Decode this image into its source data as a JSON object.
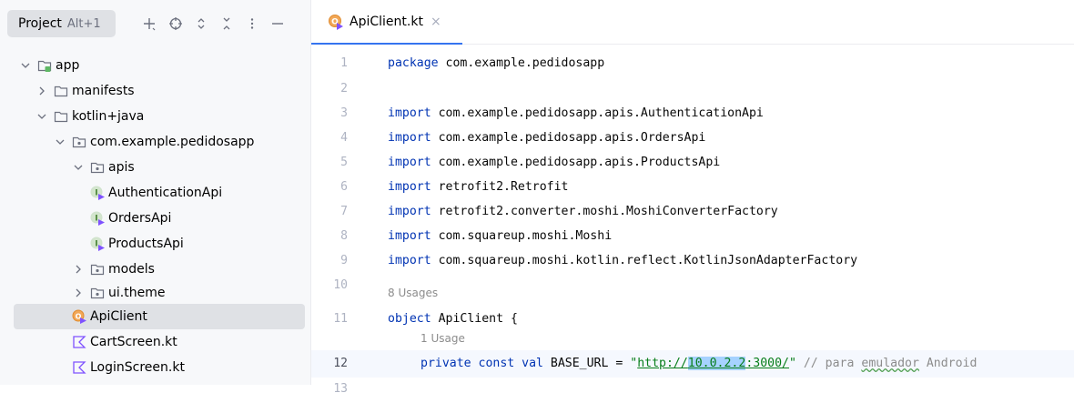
{
  "project_panel": {
    "title": "Project",
    "shortcut": "Alt+1",
    "header_icons": [
      "plus-icon",
      "crosshair-icon",
      "expand-icon",
      "collapse-icon",
      "more-icon",
      "minimize-icon"
    ],
    "tree": [
      {
        "label": "app",
        "icon": "module-folder-icon",
        "expanded": true
      },
      {
        "label": "manifests",
        "icon": "folder-icon",
        "expanded": false
      },
      {
        "label": "kotlin+java",
        "icon": "folder-icon",
        "expanded": true
      },
      {
        "label": "com.example.pedidosapp",
        "icon": "package-icon",
        "expanded": true
      },
      {
        "label": "apis",
        "icon": "package-icon",
        "expanded": true
      },
      {
        "label": "AuthenticationApi",
        "icon": "kotlin-interface-icon"
      },
      {
        "label": "OrdersApi",
        "icon": "kotlin-interface-icon"
      },
      {
        "label": "ProductsApi",
        "icon": "kotlin-interface-icon"
      },
      {
        "label": "models",
        "icon": "package-icon",
        "expanded": false
      },
      {
        "label": "ui.theme",
        "icon": "package-icon",
        "expanded": false
      },
      {
        "label": "ApiClient",
        "icon": "kotlin-object-icon",
        "selected": true
      },
      {
        "label": "CartScreen.kt",
        "icon": "kotlin-file-icon"
      },
      {
        "label": "LoginScreen.kt",
        "icon": "kotlin-file-icon"
      }
    ]
  },
  "editor": {
    "tab": {
      "label": "ApiClient.kt",
      "close": "×"
    },
    "lines": [
      {
        "num": "1",
        "kw": "package",
        "rest": " com.example.pedidosapp"
      },
      {
        "num": "2"
      },
      {
        "num": "3",
        "kw": "import",
        "rest": " com.example.pedidosapp.apis.AuthenticationApi"
      },
      {
        "num": "4",
        "kw": "import",
        "rest": " com.example.pedidosapp.apis.OrdersApi"
      },
      {
        "num": "5",
        "kw": "import",
        "rest": " com.example.pedidosapp.apis.ProductsApi"
      },
      {
        "num": "6",
        "kw": "import",
        "rest": " retrofit2.Retrofit"
      },
      {
        "num": "7",
        "kw": "import",
        "rest": " retrofit2.converter.moshi.MoshiConverterFactory"
      },
      {
        "num": "8",
        "kw": "import",
        "rest": " com.squareup.moshi.Moshi"
      },
      {
        "num": "9",
        "kw": "import",
        "rest": " com.squareup.moshi.kotlin.reflect.KotlinJsonAdapterFactory"
      },
      {
        "num": "10"
      },
      {
        "num": "11",
        "kw": "object",
        "rest": " ApiClient {"
      },
      {
        "num": "12"
      },
      {
        "num": "13"
      }
    ],
    "usage_hint_object": "8 Usages",
    "usage_hint_const": "1 Usage",
    "line12": {
      "kw": "private const val",
      "name": " BASE_URL = ",
      "quote_open": "\"",
      "url_prefix": "http://",
      "url_selected": "10.0.2.2",
      "url_suffix": ":3000/",
      "quote_close": "\"",
      "comment_prefix": " // para ",
      "comment_underlined": "emulador",
      "comment_suffix": " Android"
    }
  },
  "colors": {
    "keyword": "#0033b3",
    "string": "#067d17",
    "comment": "#8c8c8c",
    "selection": "#a6d2ff",
    "tab_underline": "#3574f0"
  }
}
